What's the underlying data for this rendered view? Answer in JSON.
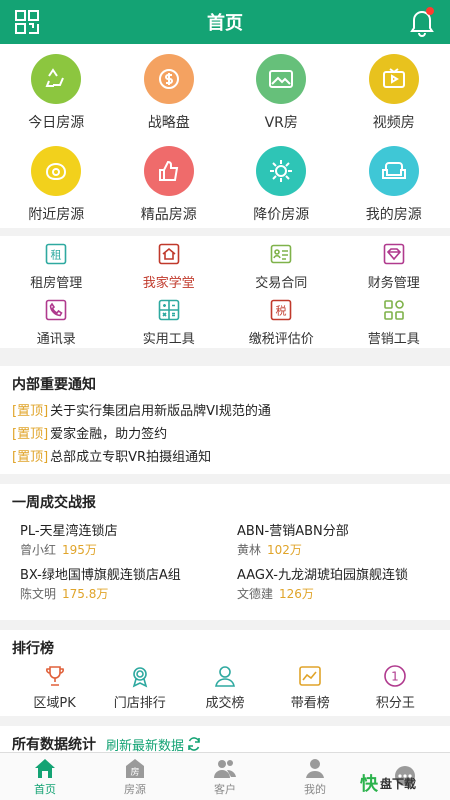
{
  "header": {
    "title": "首页"
  },
  "colors": {
    "brand": "#14a374",
    "tag": "#e0a42a"
  },
  "top_icons": [
    {
      "label": "今日房源",
      "icon": "recycle-icon",
      "color": "#8cc63f"
    },
    {
      "label": "战略盘",
      "icon": "coin-icon",
      "color": "#f4a261"
    },
    {
      "label": "VR房",
      "icon": "vr-map-icon",
      "color": "#66c07a"
    },
    {
      "label": "视频房",
      "icon": "video-icon",
      "color": "#e8c21e"
    },
    {
      "label": "附近房源",
      "icon": "location-icon",
      "color": "#f2d11c"
    },
    {
      "label": "精品房源",
      "icon": "thumbs-up-icon",
      "color": "#ef6b6b"
    },
    {
      "label": "降价房源",
      "icon": "sun-icon",
      "color": "#2ec5b6"
    },
    {
      "label": "我的房源",
      "icon": "sofa-icon",
      "color": "#3fc7d6"
    }
  ],
  "tools": [
    {
      "label": "租房管理",
      "icon": "rent-icon",
      "color": "#2ea9a0",
      "highlight": false
    },
    {
      "label": "我家学堂",
      "icon": "home-school-icon",
      "color": "#c0392b",
      "highlight": true
    },
    {
      "label": "交易合同",
      "icon": "contract-icon",
      "color": "#7fb24a",
      "highlight": false
    },
    {
      "label": "财务管理",
      "icon": "diamond-icon",
      "color": "#b03a8e",
      "highlight": false
    },
    {
      "label": "通讯录",
      "icon": "phone-icon",
      "color": "#b03a8e",
      "highlight": false
    },
    {
      "label": "实用工具",
      "icon": "calculator-icon",
      "color": "#2ea9a0",
      "highlight": false
    },
    {
      "label": "缴税评估价",
      "icon": "tax-icon",
      "color": "#c0392b",
      "highlight": false
    },
    {
      "label": "营销工具",
      "icon": "grid-apps-icon",
      "color": "#7fb24a",
      "highlight": false
    }
  ],
  "notices": {
    "title": "内部重要通知",
    "items": [
      {
        "tag": "[置顶]",
        "text": "关于实行集团启用新版品牌VI规范的通"
      },
      {
        "tag": "[置顶]",
        "text": "爱家金融，助力签约"
      },
      {
        "tag": "[置顶]",
        "text": "总部成立专职VR拍摄组通知"
      }
    ]
  },
  "report": {
    "title": "一周成交战报",
    "items": [
      {
        "store": "PL-天星湾连锁店",
        "person": "曾小红",
        "amount": "195万"
      },
      {
        "store": "ABN-营销ABN分部",
        "person": "黄林",
        "amount": "102万"
      },
      {
        "store": "BX-绿地国博旗舰连锁店A组",
        "person": "陈文明",
        "amount": "175.8万"
      },
      {
        "store": "AAGX-九龙湖琥珀园旗舰连锁",
        "person": "文德建",
        "amount": "126万"
      }
    ]
  },
  "ranking": {
    "title": "排行榜",
    "items": [
      {
        "label": "区域PK",
        "icon": "trophy-icon"
      },
      {
        "label": "门店排行",
        "icon": "medal-icon"
      },
      {
        "label": "成交榜",
        "icon": "person-icon"
      },
      {
        "label": "带看榜",
        "icon": "chart-icon"
      },
      {
        "label": "积分王",
        "icon": "number-one-icon"
      }
    ]
  },
  "stats": {
    "title": "所有数据统计",
    "refresh": "刷新最新数据"
  },
  "tabs": [
    {
      "label": "首页",
      "icon": "home-icon",
      "active": true
    },
    {
      "label": "房源",
      "icon": "house-tab-icon",
      "active": false
    },
    {
      "label": "客户",
      "icon": "customers-icon",
      "active": false
    },
    {
      "label": "我的",
      "icon": "profile-icon",
      "active": false
    },
    {
      "label": "",
      "icon": "more-icon",
      "active": false
    }
  ],
  "watermark": {
    "a": "快",
    "b": "盘下载"
  }
}
